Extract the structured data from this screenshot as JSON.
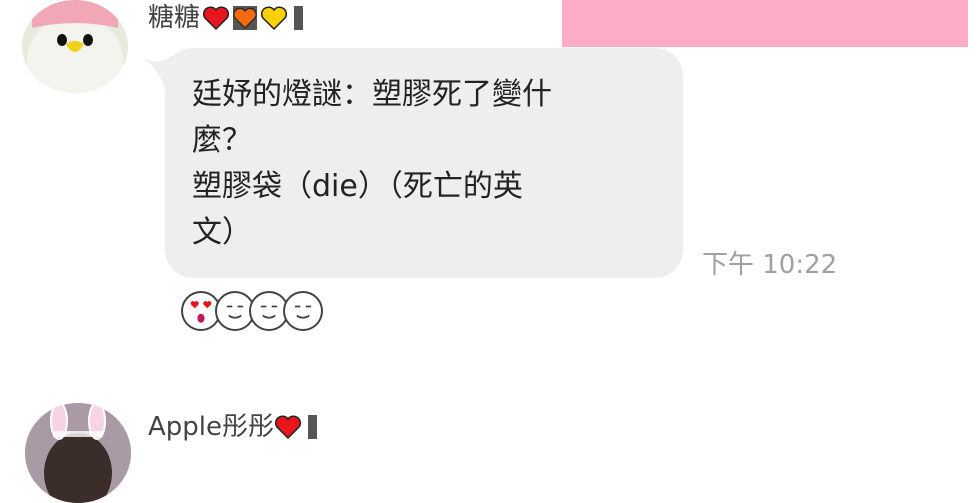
{
  "message1": {
    "sender": "糖糖",
    "emoji_icons": [
      "red-heart-icon",
      "orange-heart-icon",
      "yellow-heart-icon"
    ],
    "lines": [
      "廷妤的燈謎：塑膠死了變什",
      "麼？",
      "塑膠袋（die）（死亡的英",
      "文）"
    ],
    "time": "下午 10:22",
    "reactions": [
      "heart-eyes-icon",
      "smile-face-icon",
      "smile-face-icon",
      "smile-face-icon"
    ]
  },
  "message2": {
    "sender": "Apple彤彤",
    "emoji_icons": [
      "red-heart-icon"
    ]
  },
  "colors": {
    "bubble": "#eeeeee",
    "banner": "#ffadc7",
    "timestamp": "#a0a0a0",
    "red_heart": "#e8141e",
    "orange_heart": "#f36a10",
    "yellow_heart": "#f8d10a"
  }
}
